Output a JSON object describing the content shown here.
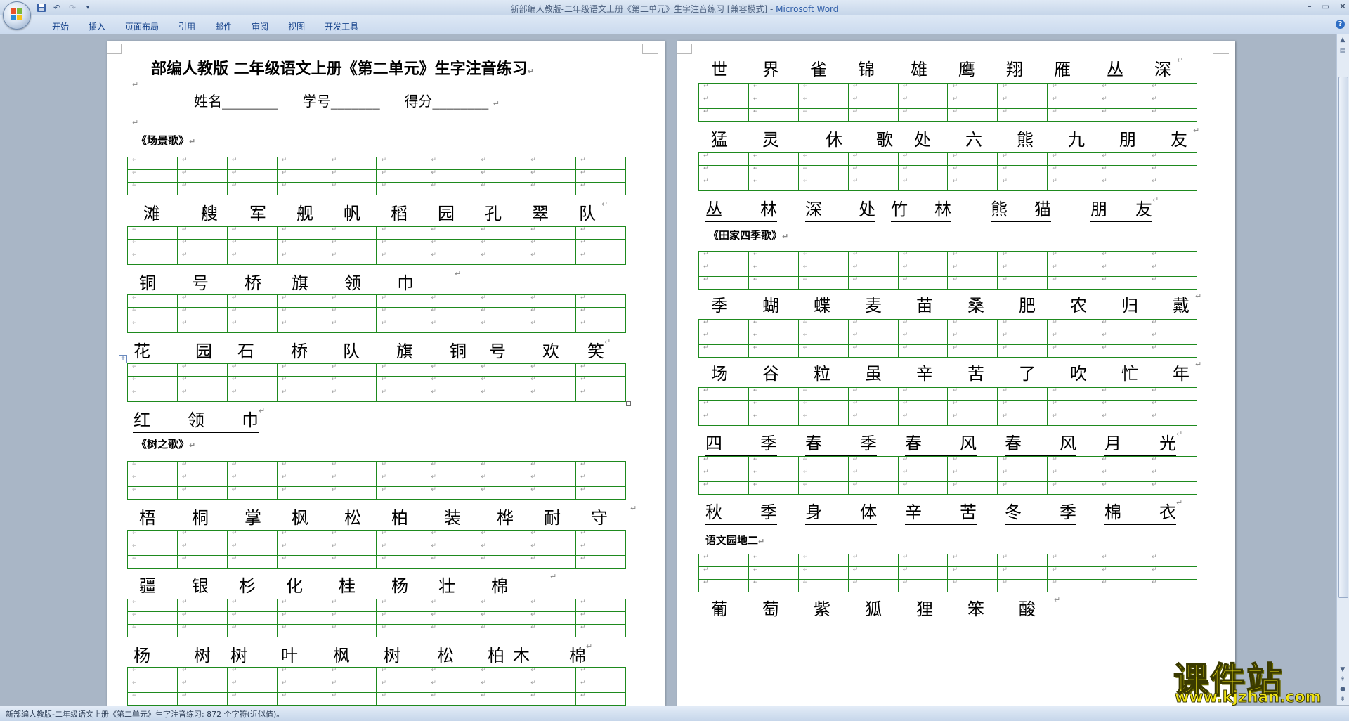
{
  "window": {
    "title": "新部编人教版-二年级语文上册《第二单元》生字注音练习 [兼容模式]",
    "app_name": "Microsoft Word"
  },
  "quick_access": [
    "save-icon",
    "undo-icon",
    "redo-icon",
    "customize-icon"
  ],
  "ribbon_tabs": [
    "开始",
    "插入",
    "页面布局",
    "引用",
    "邮件",
    "审阅",
    "视图",
    "开发工具"
  ],
  "status": {
    "text": "新部编人教版-二年级语文上册《第二单元》生字注音练习: 872 个字符(近似值)。"
  },
  "left_page": {
    "title": "部编人教版 二年级语文上册《第二单元》生字注音练习",
    "name_label": "姓名________",
    "id_label": "学号_______",
    "score_label": "得分________",
    "section1": "《场景歌》",
    "row1": [
      "滩",
      "艘",
      "军",
      "舰",
      "帆",
      "稻",
      "园",
      "孔",
      "翠",
      "队"
    ],
    "row2": [
      "铜",
      "号",
      "桥",
      "旗",
      "领",
      "巾"
    ],
    "row3": [
      "花",
      "园",
      "石",
      "桥",
      "队",
      "旗",
      "铜",
      "号",
      "欢",
      "笑"
    ],
    "row4": [
      "红",
      "领",
      "巾"
    ],
    "section2": "《树之歌》",
    "row5": [
      "梧",
      "桐",
      "掌",
      "枫",
      "松",
      "柏",
      "装",
      "桦",
      "耐",
      "守"
    ],
    "row6": [
      "疆",
      "银",
      "杉",
      "化",
      "桂",
      "杨",
      "壮",
      "棉"
    ],
    "row7": [
      "杨",
      "树",
      "树",
      "叶",
      "枫",
      "树",
      "松",
      "柏",
      "木",
      "棉"
    ]
  },
  "right_page": {
    "row1": [
      "世",
      "界",
      "雀",
      "锦",
      "雄",
      "鹰",
      "翔",
      "雁",
      "丛",
      "深"
    ],
    "row2": [
      "猛",
      "灵",
      "休",
      "歌",
      "处",
      "六",
      "熊",
      "九",
      "朋",
      "友"
    ],
    "row3": [
      "丛",
      "林",
      "深",
      "处",
      "竹",
      "林",
      "熊",
      "猫",
      "朋",
      "友"
    ],
    "section1": "《田家四季歌》",
    "row4": [
      "季",
      "蝴",
      "蝶",
      "麦",
      "苗",
      "桑",
      "肥",
      "农",
      "归",
      "戴"
    ],
    "row5": [
      "场",
      "谷",
      "粒",
      "虽",
      "辛",
      "苦",
      "了",
      "吹",
      "忙",
      "年"
    ],
    "row6": [
      "四",
      "季",
      "春",
      "季",
      "春",
      "风",
      "春",
      "风",
      "月",
      "光"
    ],
    "row7": [
      "秋",
      "季",
      "身",
      "体",
      "辛",
      "苦",
      "冬",
      "季",
      "棉",
      "衣"
    ],
    "section2": "语文园地二",
    "row8": [
      "葡",
      "萄",
      "紫",
      "狐",
      "狸",
      "笨",
      "酸"
    ]
  },
  "watermark": {
    "title": "课件站",
    "url": "www.kjzhan.com"
  },
  "colors": {
    "grid_border": "#1e8a1e",
    "ribbon_bg": "#cbdaee",
    "workspace_bg": "#a9b6c6",
    "watermark_yellow": "#f2e513"
  }
}
